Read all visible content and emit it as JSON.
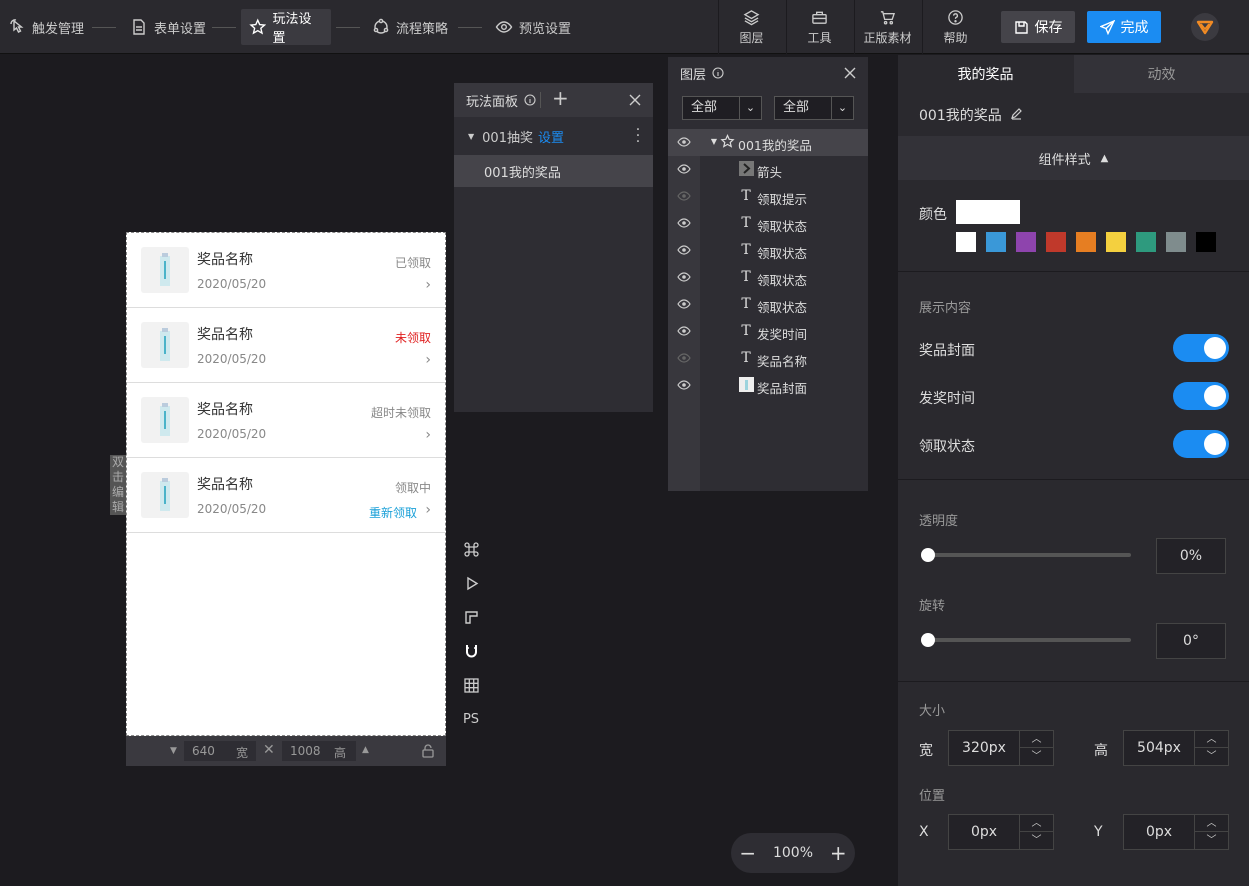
{
  "steps": [
    {
      "label": "触发管理"
    },
    {
      "label": "表单设置"
    },
    {
      "label": "玩法设置"
    },
    {
      "label": "流程策略"
    },
    {
      "label": "预览设置"
    }
  ],
  "tools": [
    {
      "label": "图层"
    },
    {
      "label": "工具"
    },
    {
      "label": "正版素材"
    },
    {
      "label": "帮助"
    }
  ],
  "save_label": "保存",
  "done_label": "完成",
  "phone": {
    "prizes": [
      {
        "name": "奖品名称",
        "date": "2020/05/20",
        "status": "已领取",
        "extra": ""
      },
      {
        "name": "奖品名称",
        "date": "2020/05/20",
        "status": "未领取",
        "extra": ""
      },
      {
        "name": "奖品名称",
        "date": "2020/05/20",
        "status": "超时未领取",
        "extra": ""
      },
      {
        "name": "奖品名称",
        "date": "2020/05/20",
        "status": "领取中",
        "extra": "重新领取"
      }
    ],
    "dblclick_hint": "双击编辑",
    "width": "640",
    "width_unit": "宽",
    "height": "1008",
    "height_unit": "高"
  },
  "side_tools": {
    "ps": "PS"
  },
  "play_panel": {
    "title": "玩法面板",
    "group": "001抽奖",
    "group_link": "设置",
    "item": "001我的奖品"
  },
  "layers_panel": {
    "title": "图层",
    "filter1": "全部",
    "filter2": "全部",
    "rows": [
      {
        "label": "001我的奖品",
        "icon": "component-icon"
      },
      {
        "label": "箭头",
        "icon": "image-icon"
      },
      {
        "label": "领取提示",
        "icon": "text-icon"
      },
      {
        "label": "领取状态",
        "icon": "text-icon"
      },
      {
        "label": "领取状态",
        "icon": "text-icon"
      },
      {
        "label": "领取状态",
        "icon": "text-icon"
      },
      {
        "label": "领取状态",
        "icon": "text-icon"
      },
      {
        "label": "发奖时间",
        "icon": "text-icon"
      },
      {
        "label": "奖品名称",
        "icon": "text-icon"
      },
      {
        "label": "奖品封面",
        "icon": "image-icon"
      }
    ]
  },
  "right_panel": {
    "tab1": "我的奖品",
    "tab2": "动效",
    "component_name": "001我的奖品",
    "style_section": "组件样式",
    "color_label": "颜色",
    "swatches": [
      "#ffffff",
      "#3a98d8",
      "#8e44ad",
      "#c0392b",
      "#e67e22",
      "#f4d03f",
      "#2e9a7e",
      "#7f8c8d",
      "#000000"
    ],
    "display_title": "展示内容",
    "toggles": [
      {
        "label": "奖品封面",
        "on": true
      },
      {
        "label": "发奖时间",
        "on": true
      },
      {
        "label": "领取状态",
        "on": true
      }
    ],
    "opacity_label": "透明度",
    "opacity_value": "0%",
    "rotate_label": "旋转",
    "rotate_value": "0°",
    "size_title": "大小",
    "width_label": "宽",
    "width_value": "320px",
    "height_label": "高",
    "height_value": "504px",
    "position_title": "位置",
    "x_label": "X",
    "x_value": "0px",
    "y_label": "Y",
    "y_value": "0px"
  },
  "zoom": {
    "value": "100%",
    "minus": "−",
    "plus": "+"
  },
  "colors": {
    "accent": "#1b8cf2",
    "danger": "#e02020",
    "link": "#1aa0d8"
  }
}
